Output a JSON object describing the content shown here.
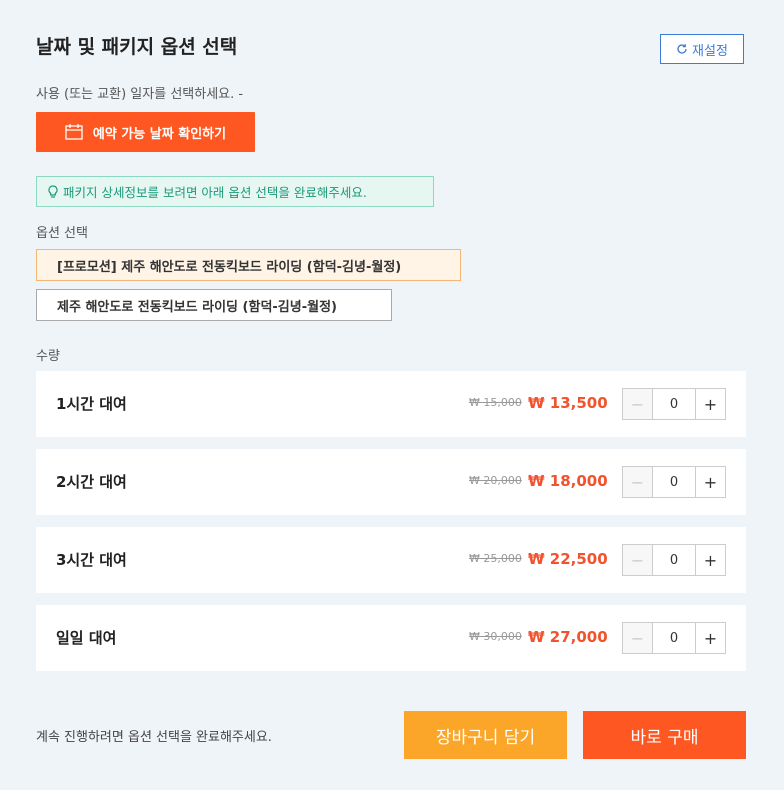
{
  "header": {
    "title": "날짜 및 패키지 옵션 선택",
    "reset_label": "재설정"
  },
  "date": {
    "instruction": "사용 (또는 교환) 일자를 선택하세요. -",
    "button_label": "예약 가능 날짜 확인하기"
  },
  "tip": {
    "text": "패키지 상세정보를 보려면 아래 옵션 선택을 완료해주세요."
  },
  "options": {
    "label": "옵션 선택",
    "items": [
      {
        "label": "[프로모션] 제주 해안도로 전동킥보드 라이딩 (함덕-김녕-월정)"
      },
      {
        "label": "제주 해안도로 전동킥보드 라이딩 (함덕-김녕-월정)"
      }
    ]
  },
  "quantity": {
    "label": "수량",
    "rows": [
      {
        "name": "1시간 대여",
        "original_price": "₩ 15,000",
        "price": "₩ 13,500",
        "qty": "0"
      },
      {
        "name": "2시간 대여",
        "original_price": "₩ 20,000",
        "price": "₩ 18,000",
        "qty": "0"
      },
      {
        "name": "3시간 대여",
        "original_price": "₩ 25,000",
        "price": "₩ 22,500",
        "qty": "0"
      },
      {
        "name": "일일 대여",
        "original_price": "₩ 30,000",
        "price": "₩ 27,000",
        "qty": "0"
      }
    ],
    "minus_symbol": "−",
    "plus_symbol": "+"
  },
  "footer": {
    "notice": "계속 진행하려면 옵션 선택을 완료해주세요.",
    "cart_label": "장바구니 담기",
    "buy_label": "바로 구매"
  },
  "colors": {
    "accent": "#ff5722",
    "cart": "#fba628",
    "link": "#3d7bd8",
    "tip": "#1a9a79"
  }
}
